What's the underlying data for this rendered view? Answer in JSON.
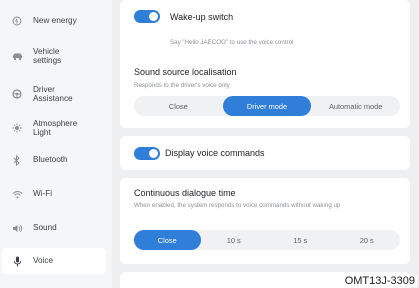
{
  "sidebar": {
    "items": [
      {
        "label": "New energy",
        "icon": "new-energy-icon"
      },
      {
        "label": "Vehicle\nsettings",
        "icon": "vehicle-icon"
      },
      {
        "label": "Driver\nAssistance",
        "icon": "steering-wheel-icon"
      },
      {
        "label": "Atmosphere\nLight",
        "icon": "light-icon"
      },
      {
        "label": "Bluetooth",
        "icon": "bluetooth-icon"
      },
      {
        "label": "Wi-Fi",
        "icon": "wifi-icon"
      },
      {
        "label": "Sound",
        "icon": "speaker-icon"
      },
      {
        "label": "Voice",
        "icon": "microphone-icon",
        "active": true
      }
    ]
  },
  "wakeup": {
    "title": "Wake-up switch",
    "subtitle": "Say \"Hello JAECOO\" to use the voice control",
    "enabled": true
  },
  "sound_source": {
    "title": "Sound source localisation",
    "subtitle": "Responds to the driver's voice only",
    "options": [
      "Close",
      "Driver mode",
      "Automatic mode"
    ],
    "selected": "Driver mode"
  },
  "display_commands": {
    "title": "Display voice commands",
    "enabled": true
  },
  "dialogue": {
    "title": "Continuous dialogue time",
    "subtitle": "When enabled, the system responds to voice commands without waking up",
    "options": [
      "Close",
      "10 s",
      "15 s",
      "20 s"
    ],
    "selected": "Close"
  },
  "watermark": "OMT13J-3309",
  "colors": {
    "accent": "#2f7ed8",
    "background": "#eeeff1",
    "card": "#ffffff"
  }
}
